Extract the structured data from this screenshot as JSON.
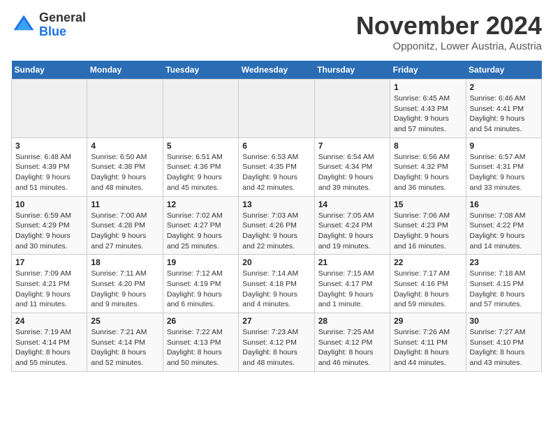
{
  "header": {
    "logo_line1": "General",
    "logo_line2": "Blue",
    "month_title": "November 2024",
    "location": "Opponitz, Lower Austria, Austria"
  },
  "weekdays": [
    "Sunday",
    "Monday",
    "Tuesday",
    "Wednesday",
    "Thursday",
    "Friday",
    "Saturday"
  ],
  "weeks": [
    [
      {
        "day": "",
        "info": ""
      },
      {
        "day": "",
        "info": ""
      },
      {
        "day": "",
        "info": ""
      },
      {
        "day": "",
        "info": ""
      },
      {
        "day": "",
        "info": ""
      },
      {
        "day": "1",
        "info": "Sunrise: 6:45 AM\nSunset: 4:43 PM\nDaylight: 9 hours and 57 minutes."
      },
      {
        "day": "2",
        "info": "Sunrise: 6:46 AM\nSunset: 4:41 PM\nDaylight: 9 hours and 54 minutes."
      }
    ],
    [
      {
        "day": "3",
        "info": "Sunrise: 6:48 AM\nSunset: 4:39 PM\nDaylight: 9 hours and 51 minutes."
      },
      {
        "day": "4",
        "info": "Sunrise: 6:50 AM\nSunset: 4:38 PM\nDaylight: 9 hours and 48 minutes."
      },
      {
        "day": "5",
        "info": "Sunrise: 6:51 AM\nSunset: 4:36 PM\nDaylight: 9 hours and 45 minutes."
      },
      {
        "day": "6",
        "info": "Sunrise: 6:53 AM\nSunset: 4:35 PM\nDaylight: 9 hours and 42 minutes."
      },
      {
        "day": "7",
        "info": "Sunrise: 6:54 AM\nSunset: 4:34 PM\nDaylight: 9 hours and 39 minutes."
      },
      {
        "day": "8",
        "info": "Sunrise: 6:56 AM\nSunset: 4:32 PM\nDaylight: 9 hours and 36 minutes."
      },
      {
        "day": "9",
        "info": "Sunrise: 6:57 AM\nSunset: 4:31 PM\nDaylight: 9 hours and 33 minutes."
      }
    ],
    [
      {
        "day": "10",
        "info": "Sunrise: 6:59 AM\nSunset: 4:29 PM\nDaylight: 9 hours and 30 minutes."
      },
      {
        "day": "11",
        "info": "Sunrise: 7:00 AM\nSunset: 4:28 PM\nDaylight: 9 hours and 27 minutes."
      },
      {
        "day": "12",
        "info": "Sunrise: 7:02 AM\nSunset: 4:27 PM\nDaylight: 9 hours and 25 minutes."
      },
      {
        "day": "13",
        "info": "Sunrise: 7:03 AM\nSunset: 4:26 PM\nDaylight: 9 hours and 22 minutes."
      },
      {
        "day": "14",
        "info": "Sunrise: 7:05 AM\nSunset: 4:24 PM\nDaylight: 9 hours and 19 minutes."
      },
      {
        "day": "15",
        "info": "Sunrise: 7:06 AM\nSunset: 4:23 PM\nDaylight: 9 hours and 16 minutes."
      },
      {
        "day": "16",
        "info": "Sunrise: 7:08 AM\nSunset: 4:22 PM\nDaylight: 9 hours and 14 minutes."
      }
    ],
    [
      {
        "day": "17",
        "info": "Sunrise: 7:09 AM\nSunset: 4:21 PM\nDaylight: 9 hours and 11 minutes."
      },
      {
        "day": "18",
        "info": "Sunrise: 7:11 AM\nSunset: 4:20 PM\nDaylight: 9 hours and 9 minutes."
      },
      {
        "day": "19",
        "info": "Sunrise: 7:12 AM\nSunset: 4:19 PM\nDaylight: 9 hours and 6 minutes."
      },
      {
        "day": "20",
        "info": "Sunrise: 7:14 AM\nSunset: 4:18 PM\nDaylight: 9 hours and 4 minutes."
      },
      {
        "day": "21",
        "info": "Sunrise: 7:15 AM\nSunset: 4:17 PM\nDaylight: 9 hours and 1 minute."
      },
      {
        "day": "22",
        "info": "Sunrise: 7:17 AM\nSunset: 4:16 PM\nDaylight: 8 hours and 59 minutes."
      },
      {
        "day": "23",
        "info": "Sunrise: 7:18 AM\nSunset: 4:15 PM\nDaylight: 8 hours and 57 minutes."
      }
    ],
    [
      {
        "day": "24",
        "info": "Sunrise: 7:19 AM\nSunset: 4:14 PM\nDaylight: 8 hours and 55 minutes."
      },
      {
        "day": "25",
        "info": "Sunrise: 7:21 AM\nSunset: 4:14 PM\nDaylight: 8 hours and 52 minutes."
      },
      {
        "day": "26",
        "info": "Sunrise: 7:22 AM\nSunset: 4:13 PM\nDaylight: 8 hours and 50 minutes."
      },
      {
        "day": "27",
        "info": "Sunrise: 7:23 AM\nSunset: 4:12 PM\nDaylight: 8 hours and 48 minutes."
      },
      {
        "day": "28",
        "info": "Sunrise: 7:25 AM\nSunset: 4:12 PM\nDaylight: 8 hours and 46 minutes."
      },
      {
        "day": "29",
        "info": "Sunrise: 7:26 AM\nSunset: 4:11 PM\nDaylight: 8 hours and 44 minutes."
      },
      {
        "day": "30",
        "info": "Sunrise: 7:27 AM\nSunset: 4:10 PM\nDaylight: 8 hours and 43 minutes."
      }
    ]
  ]
}
